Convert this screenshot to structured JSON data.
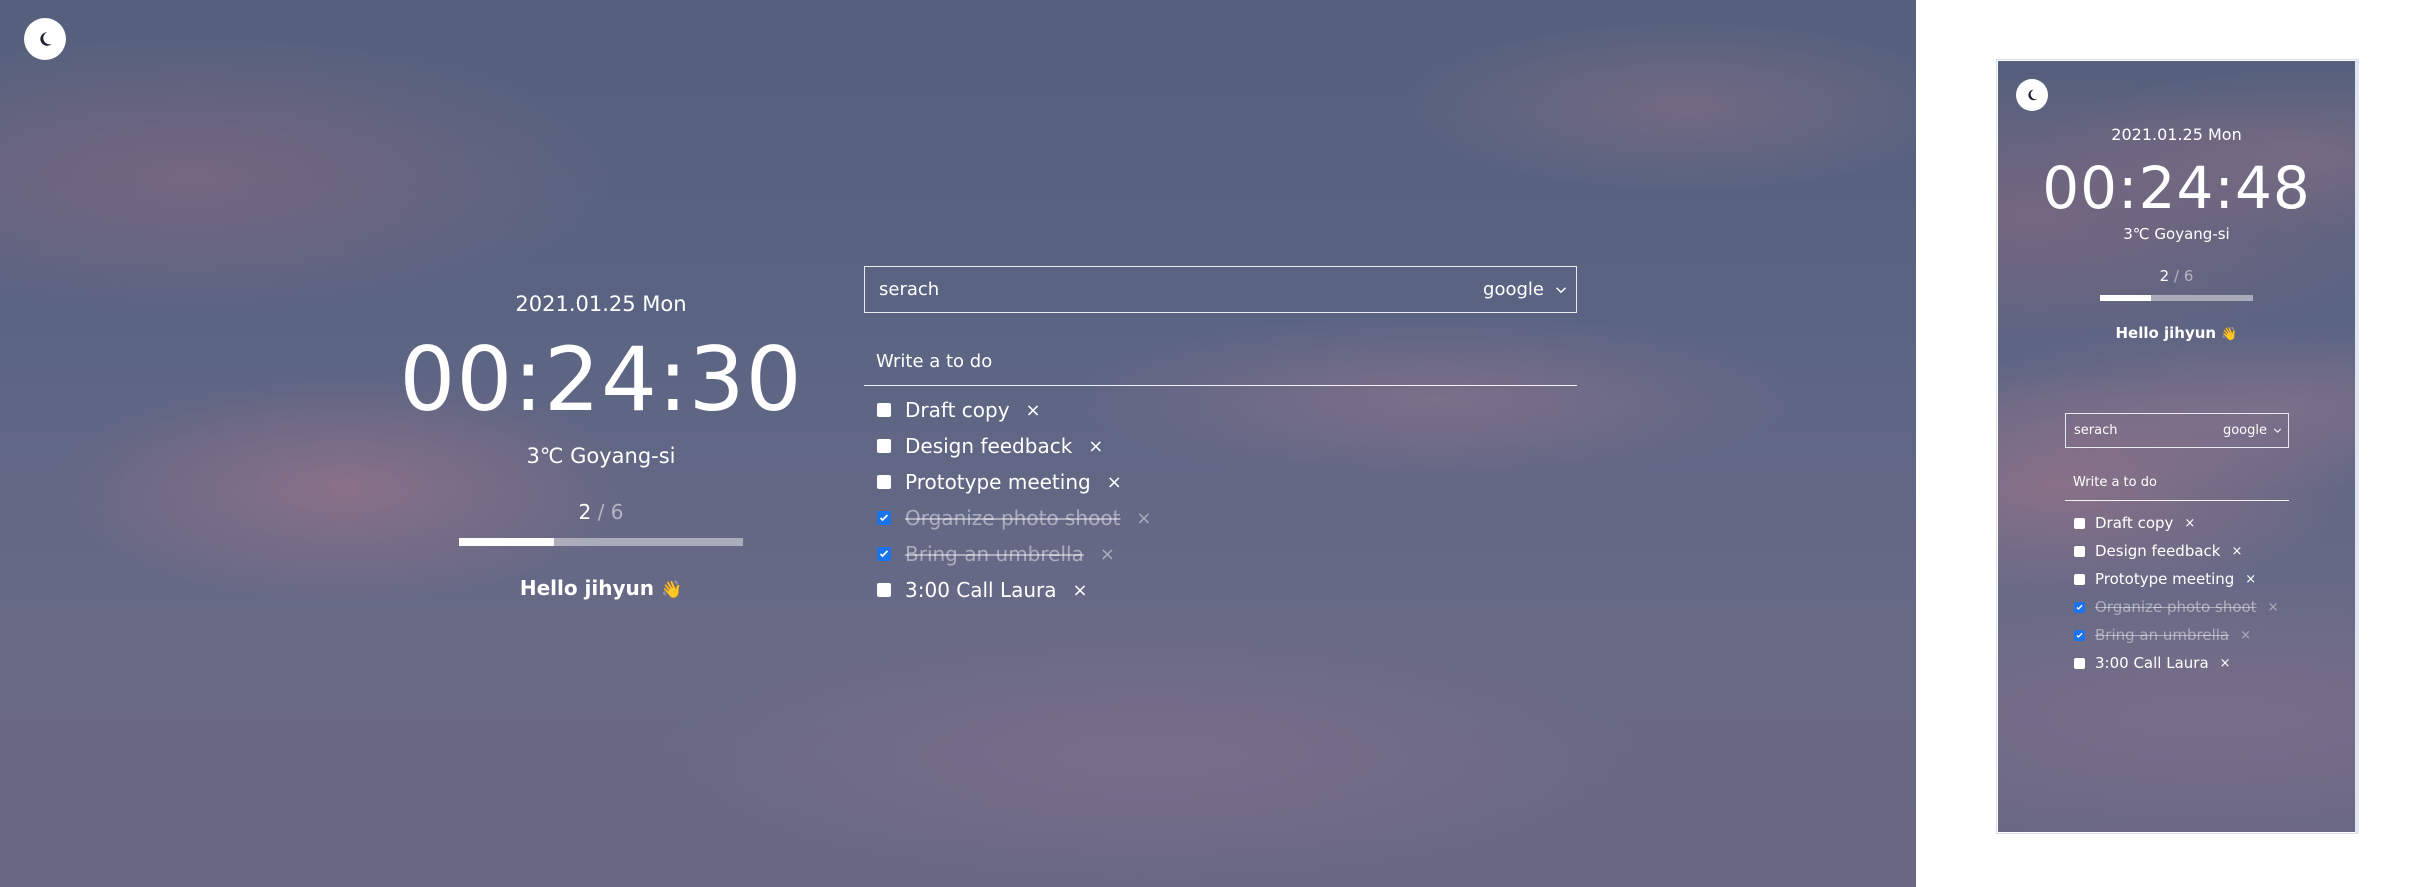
{
  "theme_toggle": {
    "icon": "crescent-moon-icon"
  },
  "clock": {
    "date": "2021.01.25 Mon",
    "time": "00:24:30",
    "time_mobile": "00:24:48"
  },
  "weather": {
    "text": "3℃ Goyang-si"
  },
  "progress": {
    "done": "2",
    "separator": "/",
    "total": "6",
    "fraction": 0.333
  },
  "greeting": {
    "text": "Hello jihyun",
    "emoji": "👋"
  },
  "search": {
    "value": "serach",
    "engine": "google"
  },
  "todo_input": {
    "placeholder": "Write a to do"
  },
  "todos": [
    {
      "text": "Draft copy",
      "done": false
    },
    {
      "text": "Design feedback",
      "done": false
    },
    {
      "text": "Prototype meeting",
      "done": false
    },
    {
      "text": "Organize photo shoot",
      "done": true
    },
    {
      "text": "Bring an umbrella",
      "done": true
    },
    {
      "text": "3:00 Call Laura",
      "done": false
    }
  ],
  "delete_glyph": "×",
  "colors": {
    "accent_checkbox": "#1a73e8",
    "text": "#ffffff"
  }
}
